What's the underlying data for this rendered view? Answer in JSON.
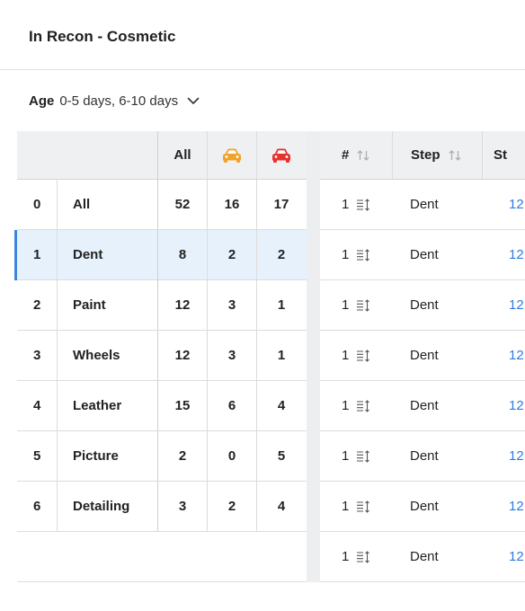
{
  "header": {
    "title": "In Recon - Cosmetic"
  },
  "filter": {
    "label": "Age",
    "value": "0-5 days, 6-10 days"
  },
  "left_table": {
    "headers": {
      "all": "All",
      "col2_icon": "car-orange-icon",
      "col3_icon": "car-red-icon"
    },
    "icon_colors": {
      "col2": "#f0a32b",
      "col3": "#e8302d"
    },
    "rows": [
      {
        "idx": "0",
        "name": "All",
        "all": "52",
        "c2": "16",
        "c3": "17"
      },
      {
        "idx": "1",
        "name": "Dent",
        "all": "8",
        "c2": "2",
        "c3": "2"
      },
      {
        "idx": "2",
        "name": "Paint",
        "all": "12",
        "c2": "3",
        "c3": "1"
      },
      {
        "idx": "3",
        "name": "Wheels",
        "all": "12",
        "c2": "3",
        "c3": "1"
      },
      {
        "idx": "4",
        "name": "Leather",
        "all": "15",
        "c2": "6",
        "c3": "4"
      },
      {
        "idx": "5",
        "name": "Picture",
        "all": "2",
        "c2": "0",
        "c3": "5"
      },
      {
        "idx": "6",
        "name": "Detailing",
        "all": "3",
        "c2": "2",
        "c3": "4"
      }
    ]
  },
  "right_table": {
    "headers": {
      "num": "#",
      "step": "Step",
      "st": "St"
    },
    "rows": [
      {
        "qty": "1",
        "step": "Dent",
        "st": "12"
      },
      {
        "qty": "1",
        "step": "Dent",
        "st": "12"
      },
      {
        "qty": "1",
        "step": "Dent",
        "st": "12"
      },
      {
        "qty": "1",
        "step": "Dent",
        "st": "12"
      },
      {
        "qty": "1",
        "step": "Dent",
        "st": "12"
      },
      {
        "qty": "1",
        "step": "Dent",
        "st": "12"
      },
      {
        "qty": "1",
        "step": "Dent",
        "st": "12"
      },
      {
        "qty": "1",
        "step": "Dent",
        "st": "12"
      }
    ]
  },
  "selected_row": 1,
  "accent_color": "#3d86e0"
}
